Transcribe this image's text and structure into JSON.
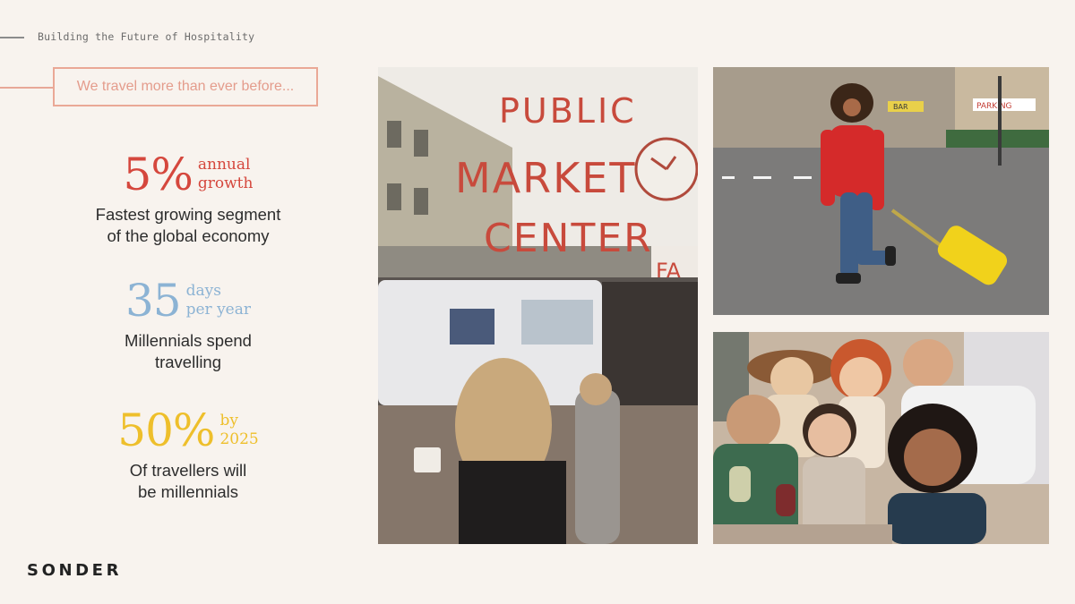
{
  "header": {
    "title": "Building the Future of Hospitality"
  },
  "tagline": "We travel more than ever before...",
  "stats": [
    {
      "value": "5%",
      "unit_line1": "annual",
      "unit_line2": "growth",
      "desc_line1": "Fastest growing segment",
      "desc_line2": "of the global economy",
      "color": "#d5473d"
    },
    {
      "value": "35",
      "unit_line1": "days",
      "unit_line2": "per year",
      "desc_line1": "Millennials spend",
      "desc_line2": "travelling",
      "color": "#8cb3d4"
    },
    {
      "value": "50%",
      "unit_line1": "by",
      "unit_line2": "2025",
      "desc_line1": "Of travellers will",
      "desc_line2": "be millennials",
      "color": "#eebf2b"
    }
  ],
  "logo": "SONDER",
  "photos": {
    "market": {
      "sign_line1": "PUBLIC",
      "sign_line2": "MARKET",
      "sign_line3": "CENTER",
      "side_sign": "FA"
    },
    "traveller": {
      "shop_sign": "PARKING",
      "shop_sign2": "BAR"
    }
  }
}
